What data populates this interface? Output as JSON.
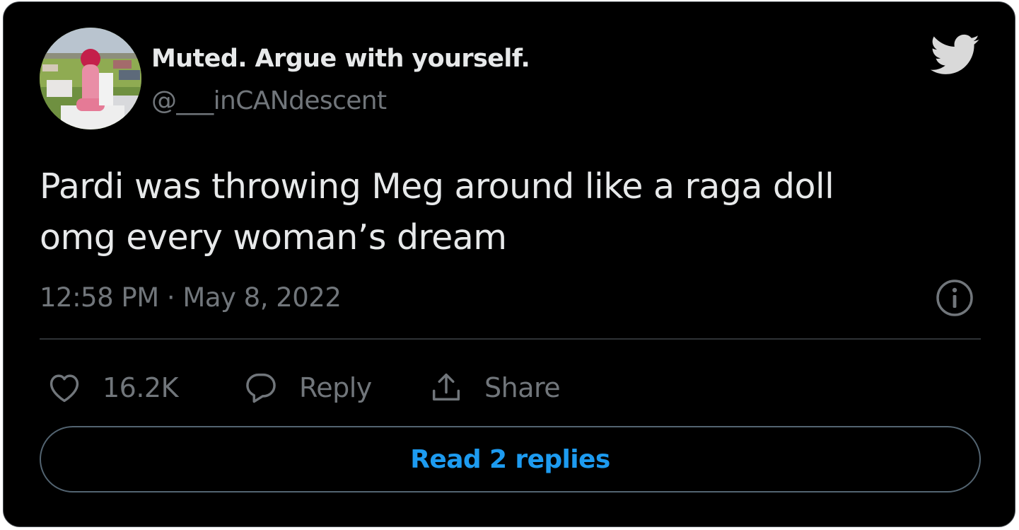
{
  "tweet": {
    "display_name": "Muted. Argue with yourself.",
    "handle": "@___inCANdescent",
    "text_lines": [
      "Pardi was throwing Meg around like a raga doll",
      "omg every woman’s dream"
    ],
    "timestamp": "12:58 PM · May 8, 2022"
  },
  "actions": {
    "like_count": "16.2K",
    "reply_label": "Reply",
    "share_label": "Share"
  },
  "read_replies_label": "Read 2 replies",
  "icons": {
    "brand": "twitter-bird-icon",
    "info": "info-icon",
    "like": "heart-icon",
    "reply": "speech-bubble-icon",
    "share": "share-upload-icon"
  },
  "colors": {
    "background": "#000000",
    "primary_text": "#e7e9ea",
    "secondary_text": "#71767b",
    "accent": "#1d9bf0",
    "border": "#2f3336",
    "bird": "#d9d9d9"
  }
}
